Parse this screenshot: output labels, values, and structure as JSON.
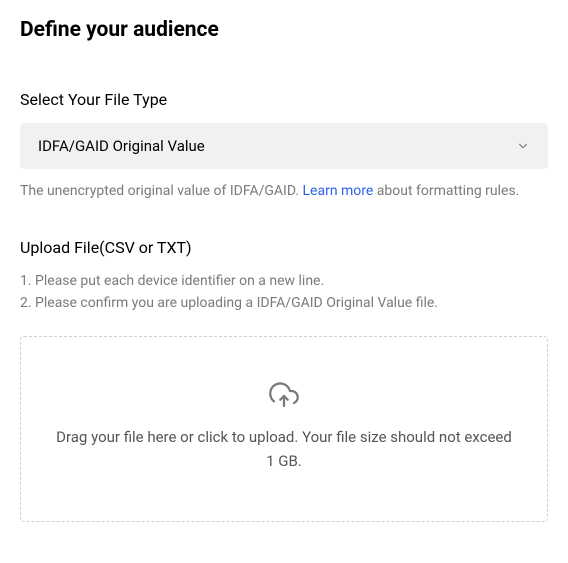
{
  "page": {
    "title": "Define your audience"
  },
  "file_type": {
    "label": "Select Your File Type",
    "selected": "IDFA/GAID Original Value",
    "helper_before": "The unencrypted original value of IDFA/GAID. ",
    "helper_link": "Learn more",
    "helper_after": " about formatting rules."
  },
  "upload": {
    "label": "Upload File(CSV or TXT)",
    "instruction1": "1. Please put each device identifier on a new line.",
    "instruction2": "2. Please confirm you are uploading a IDFA/GAID Original Value file.",
    "drop_text": "Drag your file here or click to upload. Your file size should not exceed 1 GB."
  }
}
